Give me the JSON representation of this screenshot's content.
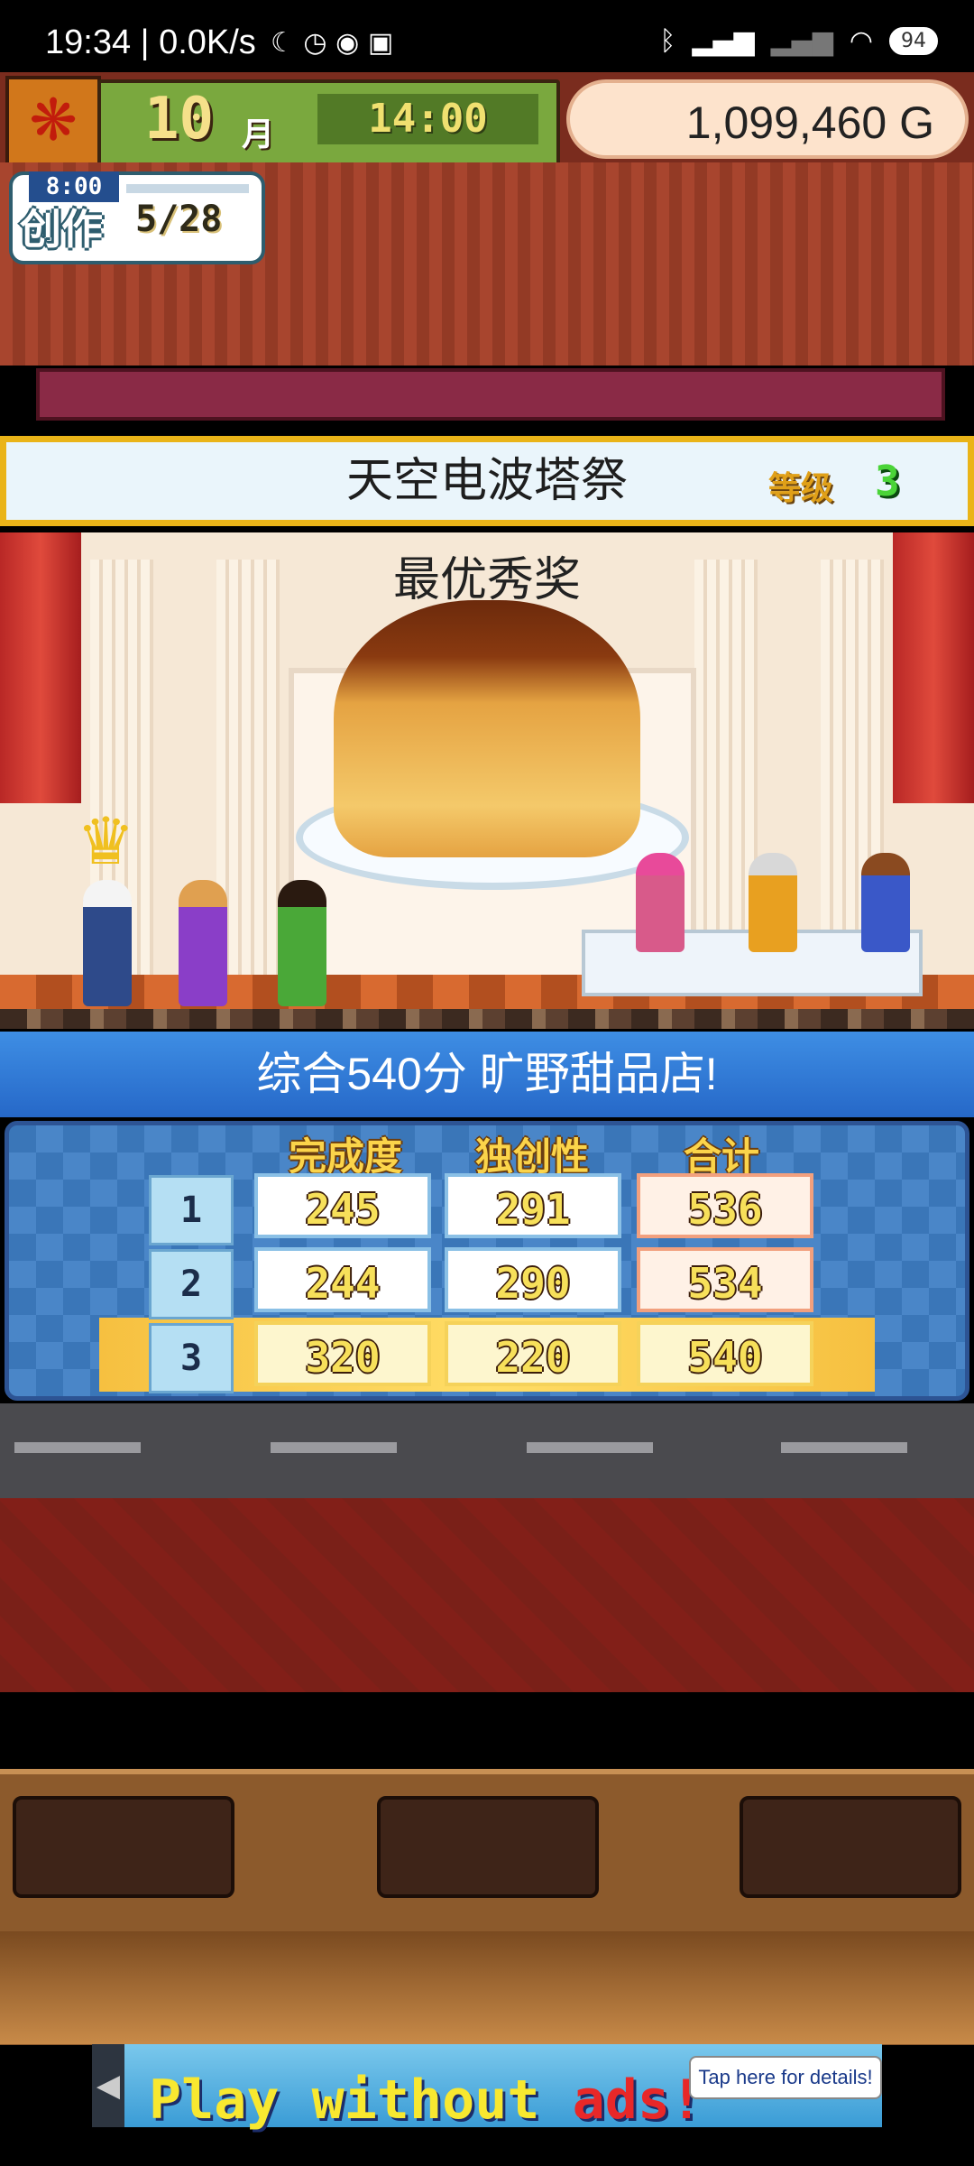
{
  "status_bar": {
    "time": "19:34 | 0.0K/s",
    "icons": [
      "moon-icon",
      "alarm-icon",
      "weibo-icon",
      "notification-icon"
    ],
    "right_icons": [
      "bluetooth-icon",
      "signal-icon",
      "signal-weak-icon",
      "wifi-icon"
    ],
    "battery": "94"
  },
  "header": {
    "month": "10",
    "month_label": "月",
    "clock": "14:00",
    "money": "1,099,460 G"
  },
  "create": {
    "label": "创作",
    "time": "8:00",
    "count": "5/28"
  },
  "contest": {
    "title": "天空电波塔祭",
    "grade_label": "等级",
    "grade_value": "3",
    "award": "最优秀奖"
  },
  "result": {
    "summary": "综合540分 旷野甜品店!",
    "headers": [
      "完成度",
      "独创性",
      "合计"
    ],
    "rows": [
      {
        "rank": "1",
        "quality": "245",
        "originality": "291",
        "total": "536"
      },
      {
        "rank": "2",
        "quality": "244",
        "originality": "290",
        "total": "534"
      },
      {
        "rank": "3",
        "quality": "320",
        "originality": "220",
        "total": "540"
      }
    ]
  },
  "ad": {
    "text_a": "Play without ",
    "text_b": "ads!",
    "info": "Tap here for details!",
    "back": "◀"
  }
}
